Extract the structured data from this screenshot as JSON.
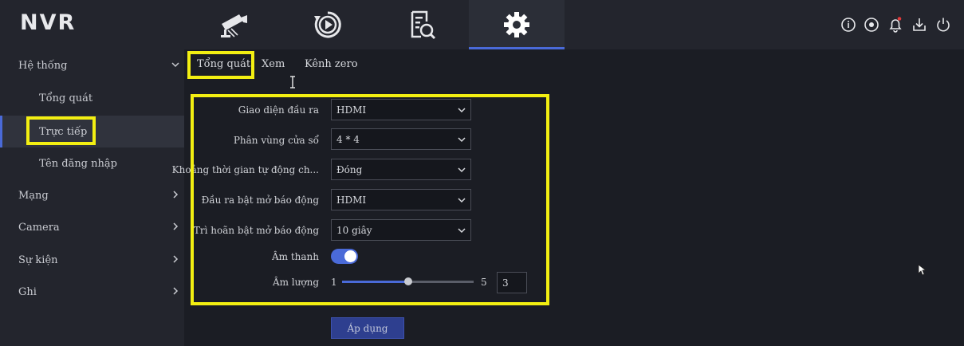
{
  "app": {
    "logo": "NVR"
  },
  "nav_tabs": [
    {
      "name": "live-view",
      "icon": "camera-icon"
    },
    {
      "name": "playback",
      "icon": "playback-icon"
    },
    {
      "name": "search",
      "icon": "file-search-icon"
    },
    {
      "name": "settings",
      "icon": "gear-icon",
      "active": true
    }
  ],
  "top_icons": [
    "info-icon",
    "record-icon",
    "bell-icon",
    "download-icon",
    "power-icon"
  ],
  "sidebar": {
    "items": [
      {
        "label": "Hệ thống",
        "type": "group",
        "chevron": "down"
      },
      {
        "label": "Tổng quát",
        "type": "sub"
      },
      {
        "label": "Trực tiếp",
        "type": "sub",
        "selected": true
      },
      {
        "label": "Tên đăng nhập",
        "type": "sub"
      },
      {
        "label": "Mạng",
        "type": "group",
        "chevron": "right"
      },
      {
        "label": "Camera",
        "type": "group",
        "chevron": "right"
      },
      {
        "label": "Sự kiện",
        "type": "group",
        "chevron": "right"
      },
      {
        "label": "Ghi",
        "type": "group",
        "chevron": "right"
      }
    ]
  },
  "subtabs": [
    {
      "label": "Tổng quát",
      "active": true
    },
    {
      "label": "Xem"
    },
    {
      "label": "Kênh zero"
    }
  ],
  "form": {
    "output_interface": {
      "label": "Giao diện đầu ra",
      "value": "HDMI"
    },
    "window_division": {
      "label": "Phân vùng cửa sổ",
      "value": "4 * 4"
    },
    "auto_switch_interval": {
      "label": "Khoảng thời gian tự động ch...",
      "value": "Đóng"
    },
    "alarm_popup_output": {
      "label": "Đầu ra bật mở báo động",
      "value": "HDMI"
    },
    "alarm_popup_delay": {
      "label": "Trì hoãn bật mở báo động",
      "value": "10 giây"
    },
    "audio": {
      "label": "Âm thanh",
      "enabled": true
    },
    "volume": {
      "label": "Âm lượng",
      "min": "1",
      "max": "5",
      "value": "3"
    }
  },
  "apply_button": {
    "label": "Áp dụng"
  },
  "colors": {
    "accent": "#4a6ad8",
    "highlight": "#f3ef12",
    "background": "#1b1d24",
    "panel": "#23252d"
  }
}
